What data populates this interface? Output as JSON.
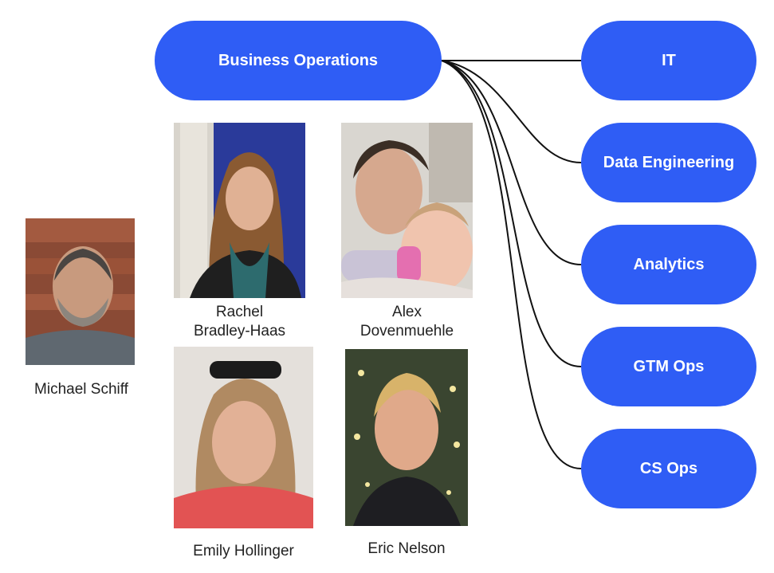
{
  "root": {
    "label": "Business Operations"
  },
  "departments": [
    {
      "label": "IT"
    },
    {
      "label": "Data Engineering"
    },
    {
      "label": "Analytics"
    },
    {
      "label": "GTM Ops"
    },
    {
      "label": "CS Ops"
    }
  ],
  "people": [
    {
      "name_lines": [
        "Michael Schiff"
      ]
    },
    {
      "name_lines": [
        "Rachel",
        "Bradley-Haas"
      ]
    },
    {
      "name_lines": [
        "Alex",
        "Dovenmuehle"
      ]
    },
    {
      "name_lines": [
        "Emily Hollinger"
      ]
    },
    {
      "name_lines": [
        "Eric Nelson"
      ]
    }
  ],
  "colors": {
    "pill": "#2f5df5",
    "pill_text": "#ffffff",
    "connector": "#111111"
  }
}
